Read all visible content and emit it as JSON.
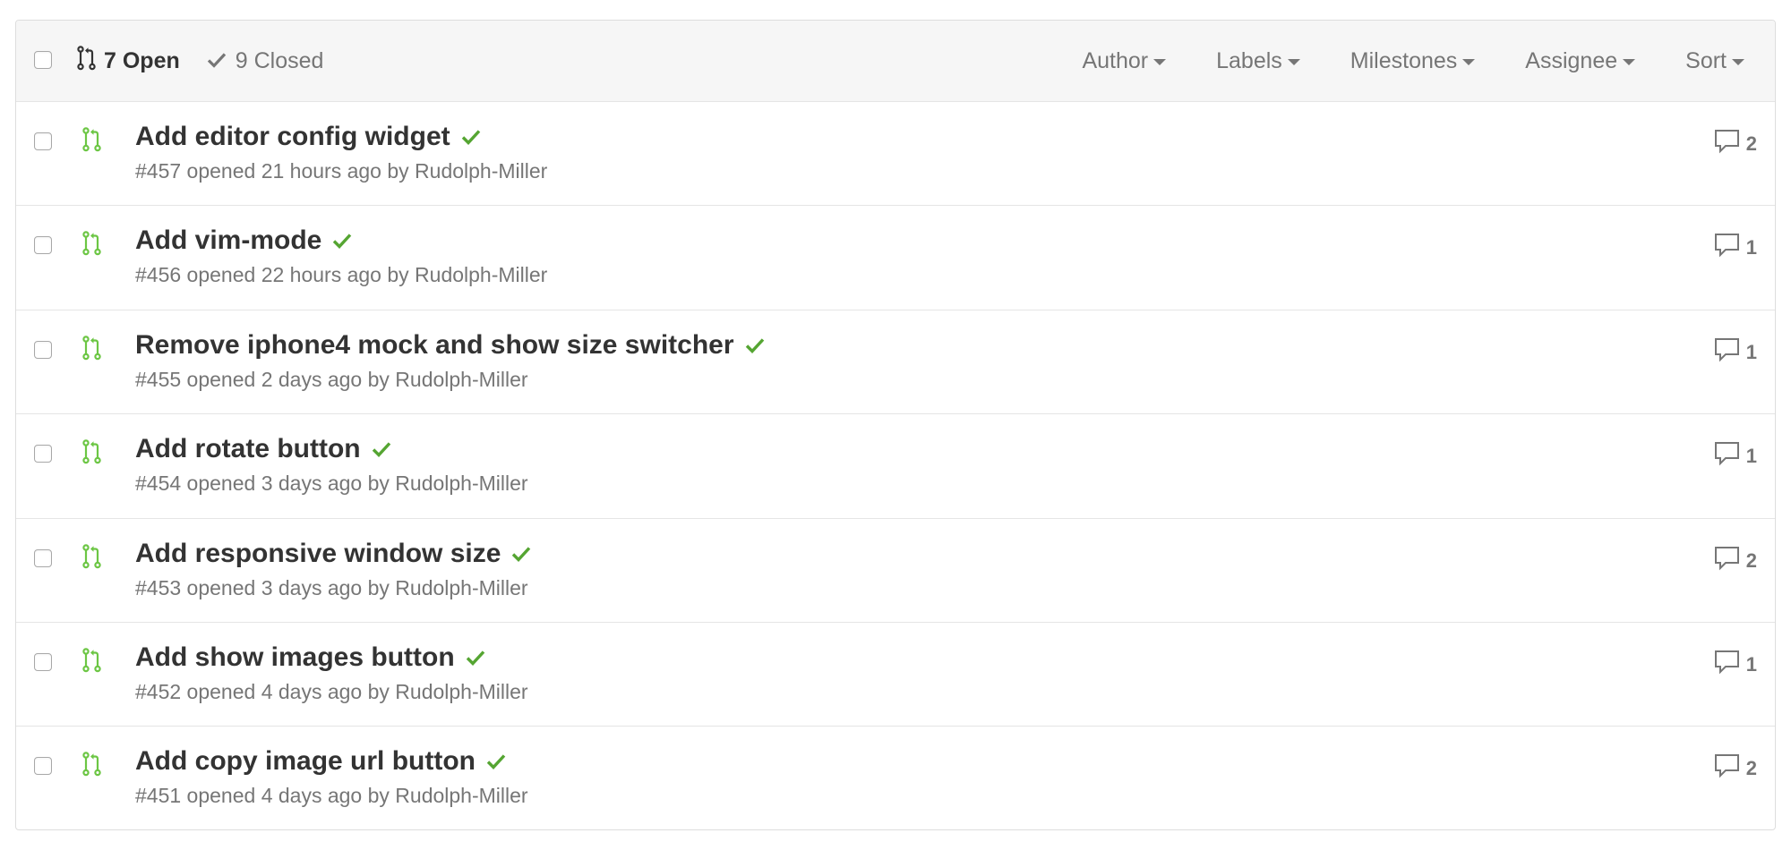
{
  "header": {
    "open_label": "7 Open",
    "closed_label": "9 Closed",
    "filters": [
      "Author",
      "Labels",
      "Milestones",
      "Assignee",
      "Sort"
    ]
  },
  "colors": {
    "accent_green": "#6cc644",
    "check_green": "#55a532",
    "text_dark": "#333333",
    "text_muted": "#767676"
  },
  "pull_requests": [
    {
      "title": "Add editor config widget",
      "meta": "#457 opened 21 hours ago by ",
      "author": "Rudolph-Miller",
      "comments": "2"
    },
    {
      "title": "Add vim-mode",
      "meta": "#456 opened 22 hours ago by ",
      "author": "Rudolph-Miller",
      "comments": "1"
    },
    {
      "title": "Remove iphone4 mock and show size switcher",
      "meta": "#455 opened 2 days ago by ",
      "author": "Rudolph-Miller",
      "comments": "1"
    },
    {
      "title": "Add rotate button",
      "meta": "#454 opened 3 days ago by ",
      "author": "Rudolph-Miller",
      "comments": "1"
    },
    {
      "title": "Add responsive window size",
      "meta": "#453 opened 3 days ago by ",
      "author": "Rudolph-Miller",
      "comments": "2"
    },
    {
      "title": "Add show images button",
      "meta": "#452 opened 4 days ago by ",
      "author": "Rudolph-Miller",
      "comments": "1"
    },
    {
      "title": "Add copy image url button",
      "meta": "#451 opened 4 days ago by ",
      "author": "Rudolph-Miller",
      "comments": "2"
    }
  ]
}
